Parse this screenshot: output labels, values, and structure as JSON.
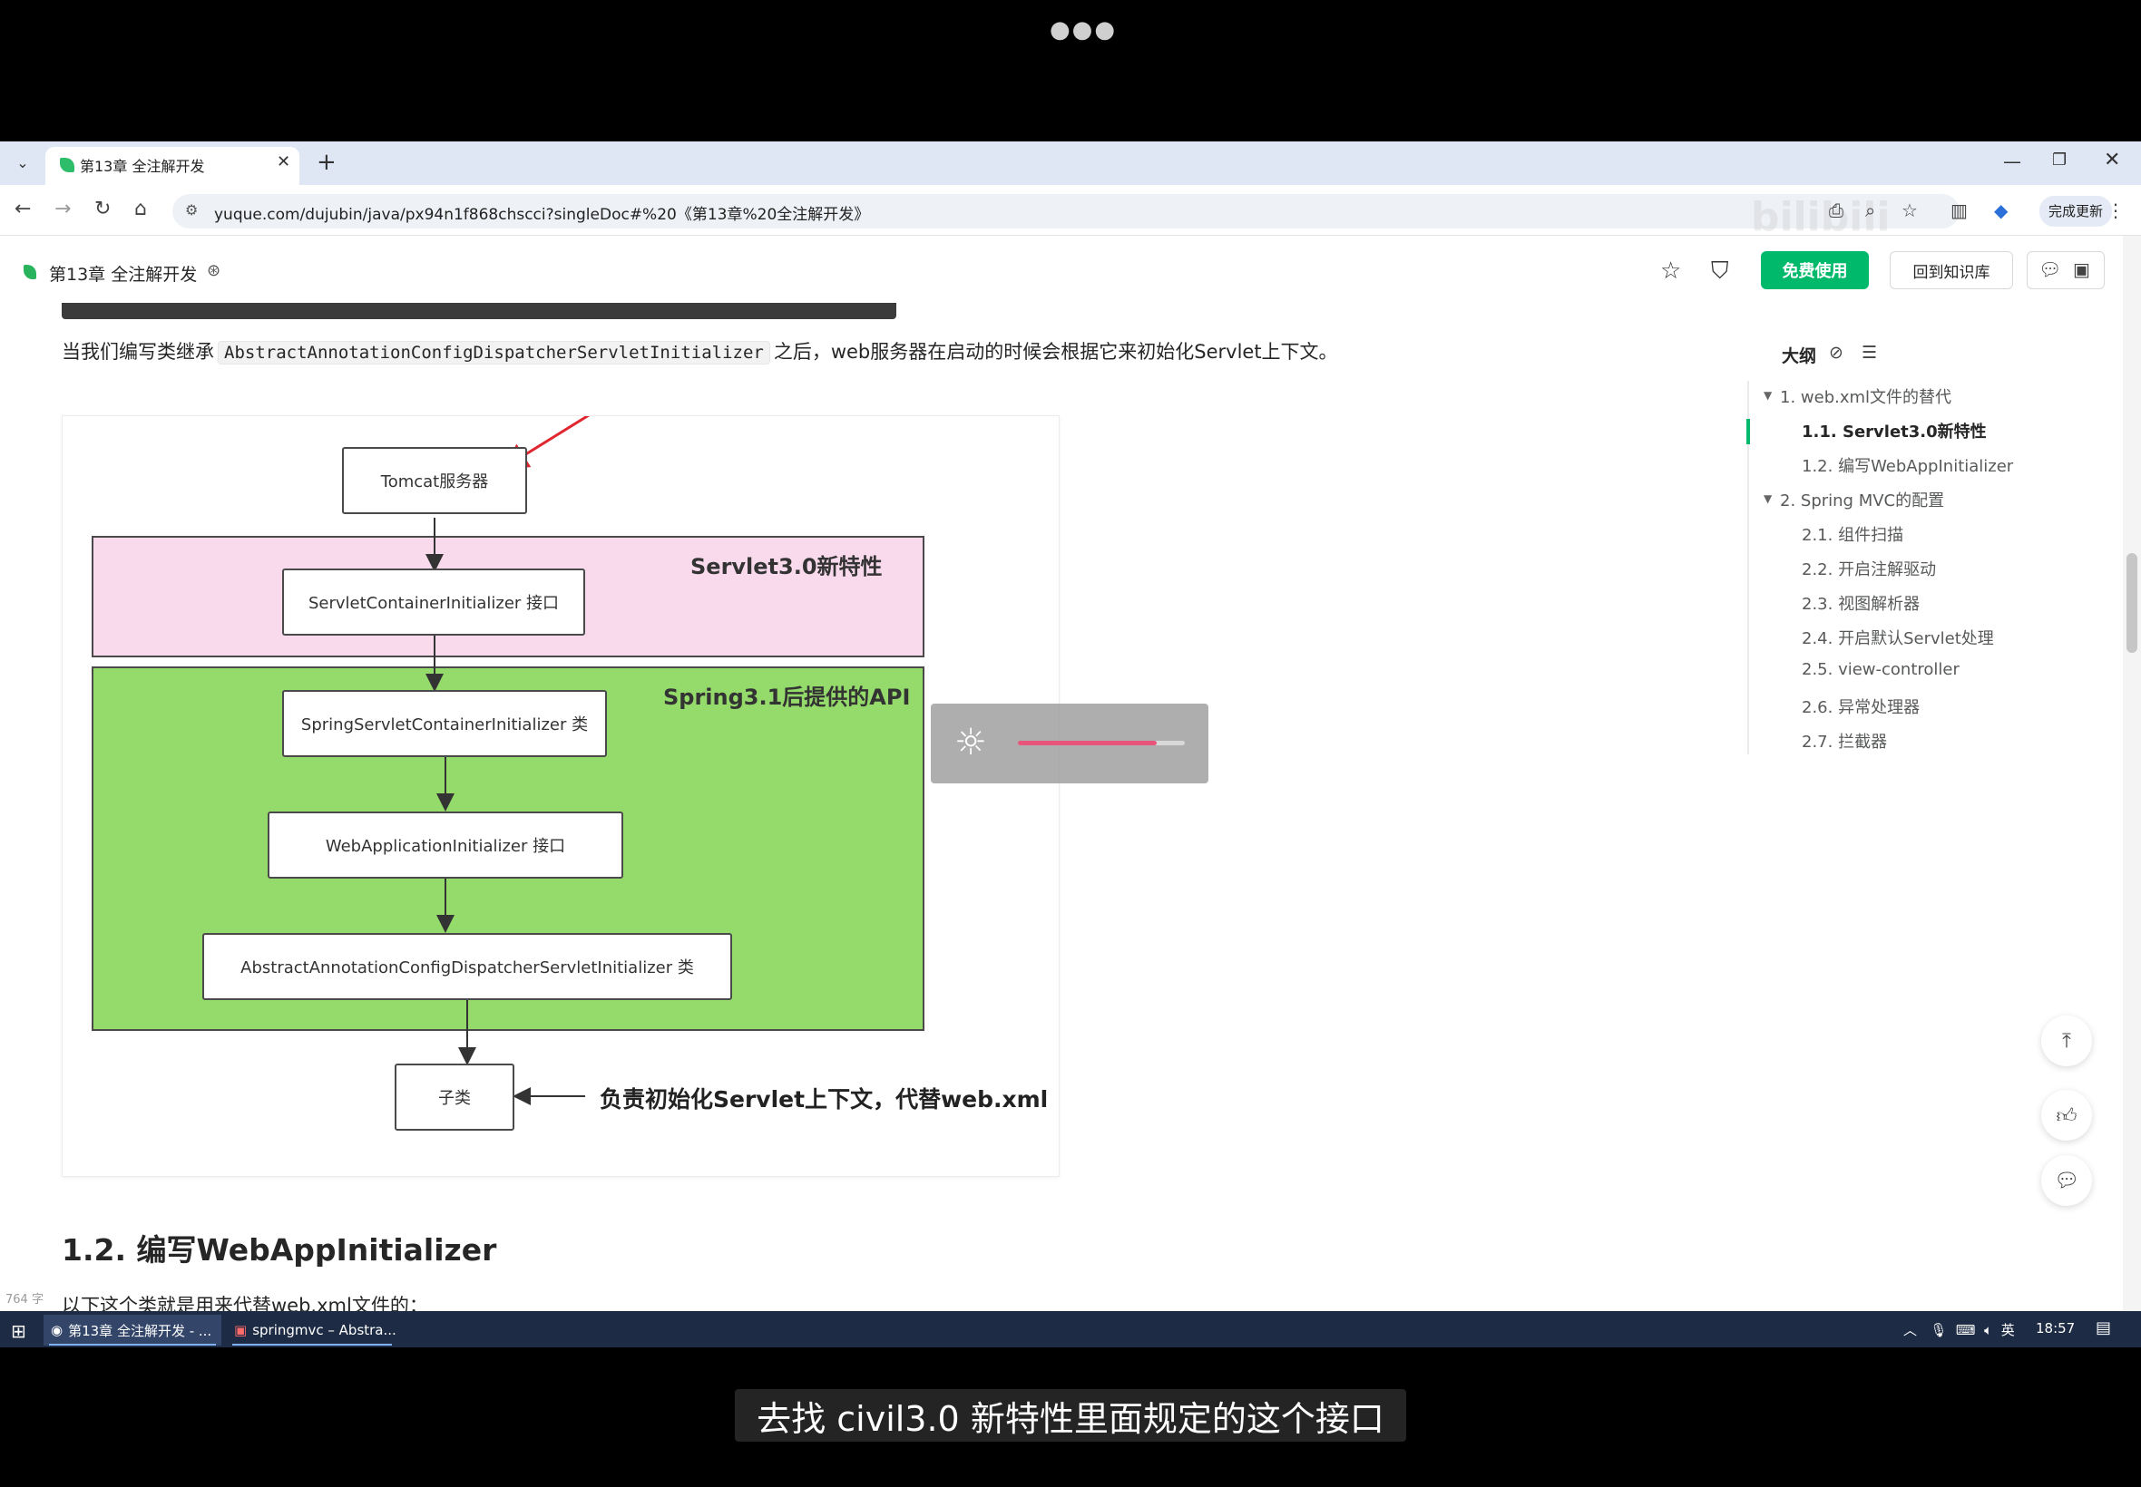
{
  "browser": {
    "tab_title": "第13章 全注解开发",
    "url": "yuque.com/dujubin/java/px94n1f868chscci?singleDoc#%20《第13章%20全注解开发》",
    "profile_label": "完成更新"
  },
  "doc_header": {
    "title": "第13章 全注解开发",
    "free_button": "免费使用",
    "back_button": "回到知识库"
  },
  "content": {
    "para_before": "当我们编写类继承",
    "para_code": "AbstractAnnotationConfigDispatcherServletInitializer",
    "para_after": "之后，web服务器在启动的时候会根据它来初始化Servlet上下文。",
    "section_heading": "1.2. 编写WebAppInitializer",
    "para2": "以下这个类就是用来代替web.xml文件的：",
    "word_count": "764 字"
  },
  "diagram": {
    "tomcat": "Tomcat服务器",
    "servlet_band_label": "Servlet3.0新特性",
    "servlet_container_initializer": "ServletContainerInitializer 接口",
    "spring_band_label": "Spring3.1后提供的API",
    "spring_servlet_container_initializer": "SpringServletContainerInitializer 类",
    "web_app_initializer": "WebApplicationInitializer 接口",
    "abstract_initializer": "AbstractAnnotationConfigDispatcherServletInitializer 类",
    "subclass": "子类",
    "note": "负责初始化Servlet上下文，代替web.xml"
  },
  "brightness": {
    "level": 0.83
  },
  "outline": {
    "title": "大纲",
    "items": [
      {
        "label": "1. web.xml文件的替代",
        "level": 1
      },
      {
        "label": "1.1. Servlet3.0新特性",
        "level": 2,
        "active": true
      },
      {
        "label": "1.2. 编写WebAppInitializer",
        "level": 2
      },
      {
        "label": "2. Spring MVC的配置",
        "level": 1
      },
      {
        "label": "2.1. 组件扫描",
        "level": 2
      },
      {
        "label": "2.2. 开启注解驱动",
        "level": 2
      },
      {
        "label": "2.3. 视图解析器",
        "level": 2
      },
      {
        "label": "2.4. 开启默认Servlet处理",
        "level": 2
      },
      {
        "label": "2.5. view-controller",
        "level": 2
      },
      {
        "label": "2.6. 异常处理器",
        "level": 2
      },
      {
        "label": "2.7. 拦截器",
        "level": 2
      }
    ]
  },
  "taskbar": {
    "task1": "第13章 全注解开发 - ...",
    "task2": "springmvc – Abstra...",
    "ime": "英",
    "time": "18:57"
  },
  "subtitle": "去找 civil3.0 新特性里面规定的这个接口",
  "colors": {
    "accent": "#00b96b",
    "pink_band": "#f9d9ec",
    "green_band": "#95db6b",
    "arrow_red": "#e0262f"
  }
}
